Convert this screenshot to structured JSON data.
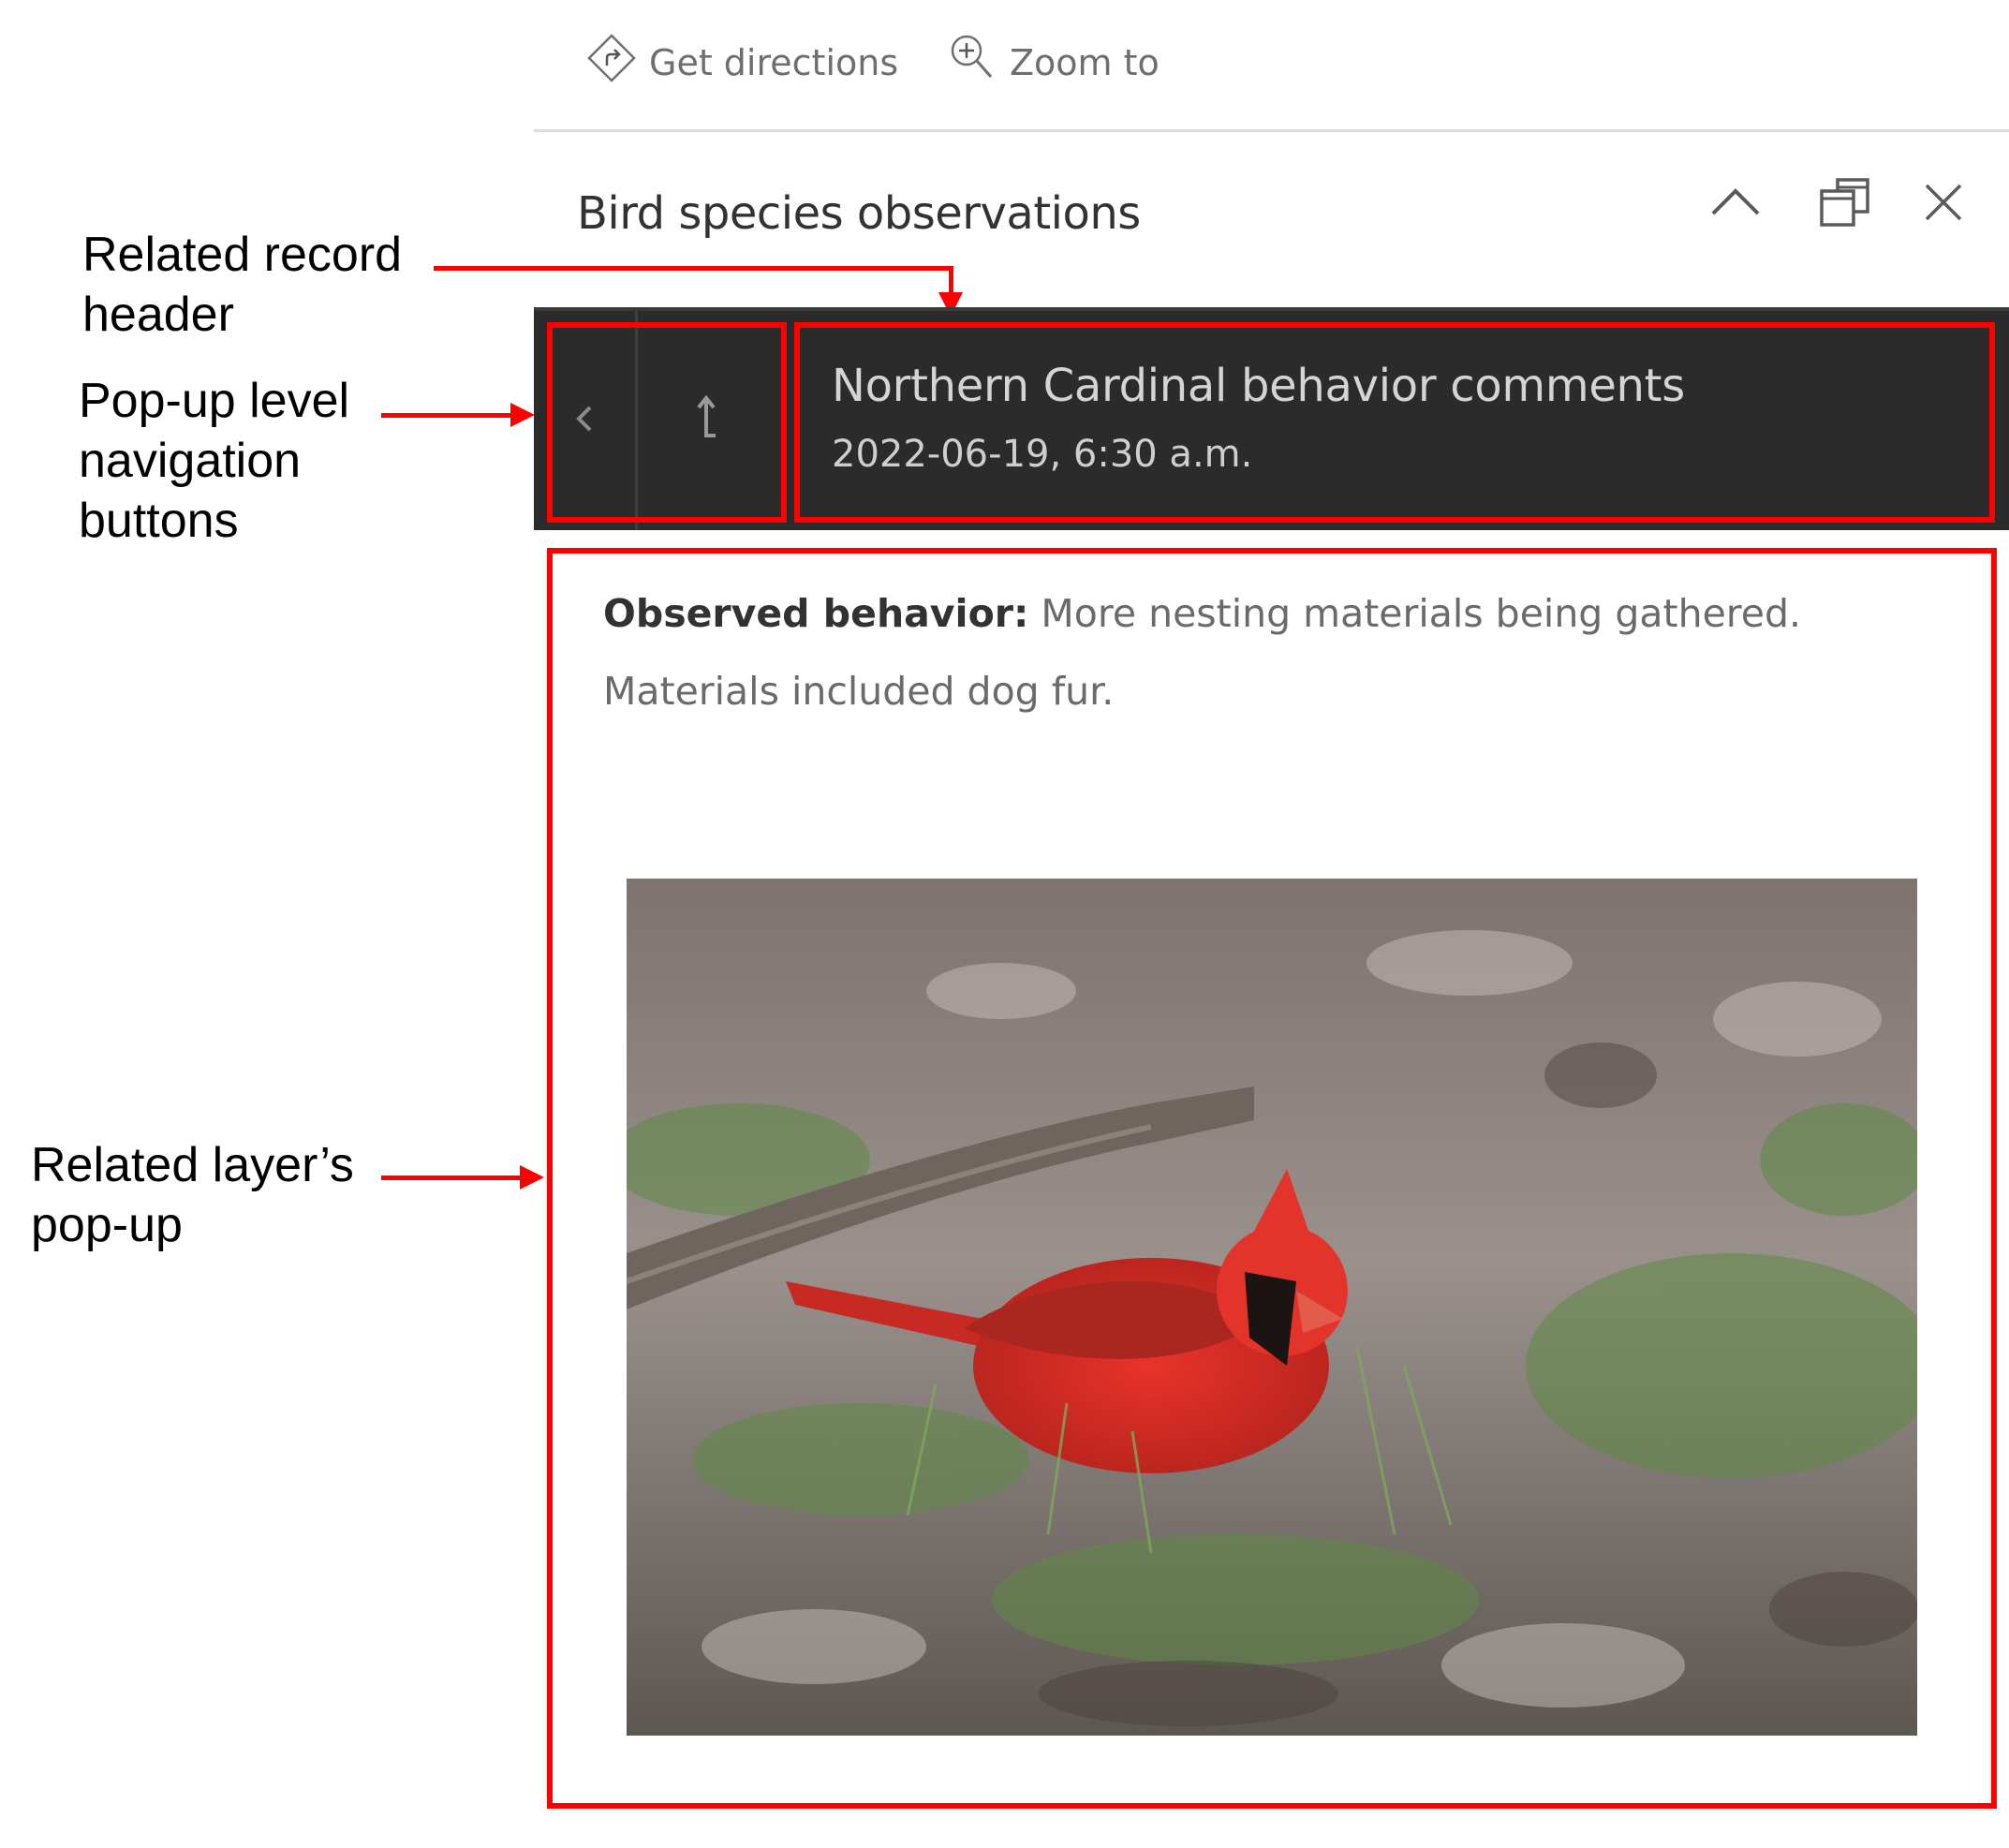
{
  "annotations": {
    "related_record_header": "Related record\nheader",
    "popup_level_navigation": "Pop-up level\nnavigation\nbuttons",
    "related_layer_popup": "Related layer’s\npop-up",
    "highlight_color": "#ff0000"
  },
  "actions": {
    "get_directions": {
      "label": "Get directions",
      "icon": "directions-icon"
    },
    "zoom_to": {
      "label": "Zoom to",
      "icon": "zoom-in-icon"
    }
  },
  "popup": {
    "title": "Bird species observations",
    "header_buttons": [
      {
        "name": "collapse",
        "icon": "chevron-up-icon"
      },
      {
        "name": "dock",
        "icon": "dock-windows-icon"
      },
      {
        "name": "close",
        "icon": "close-icon"
      }
    ]
  },
  "related_record": {
    "nav_back_icon": "chevron-left-icon",
    "nav_up_icon": "up-level-arrow-icon",
    "title": "Northern Cardinal behavior comments",
    "date": "2022-06-19, 6:30 a.m.",
    "bar_color": "#2b2b2b"
  },
  "content": {
    "field_label": "Observed behavior:",
    "field_value": " More nesting materials being gathered. Materials included dog fur.",
    "image_alt": "Northern Cardinal foraging on the ground among leaves, grass and a fallen branch"
  }
}
